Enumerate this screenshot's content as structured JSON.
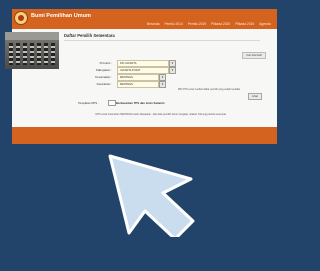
{
  "header": {
    "site_title": "Bumi Pemilihan Umum",
    "nav": [
      "Beranda",
      "Pemilu 2014",
      "Pemilu 2019",
      "Pilkada 2020",
      "Pilkada 2024",
      "Agenda"
    ]
  },
  "page": {
    "title": "Daftar Pemilih Sementara",
    "alt_button": "Cari Alternatif"
  },
  "form": {
    "rows": [
      {
        "label": "Provinsi :",
        "value": "DKI JAKARTA"
      },
      {
        "label": "Kabupaten :",
        "value": "JAKARTA PUSAT"
      },
      {
        "label": "Kecamatan :",
        "value": "MENTENG"
      },
      {
        "label": "Kelurahan :",
        "value": "MENTENG"
      }
    ],
    "hint": "Pilih TPS untuk melihat daftar pemilih yang sudah terdaftar",
    "view_button": "Lihat",
    "mode_label": "Tampilkan DPS :",
    "mode_text": "Berdasarkan TPS dan Jenis Kelamin"
  },
  "footnote": "DPS untuk Kelurahan MENTENG telah ditetapkan. Jika data pemilih belum lengkap, silakan hubungi panitia setempat.",
  "colors": {
    "accent": "#d4631f",
    "background": "#23446a"
  },
  "icons": {
    "logo": "emblem-icon",
    "cursor": "mouse-pointer-icon"
  }
}
